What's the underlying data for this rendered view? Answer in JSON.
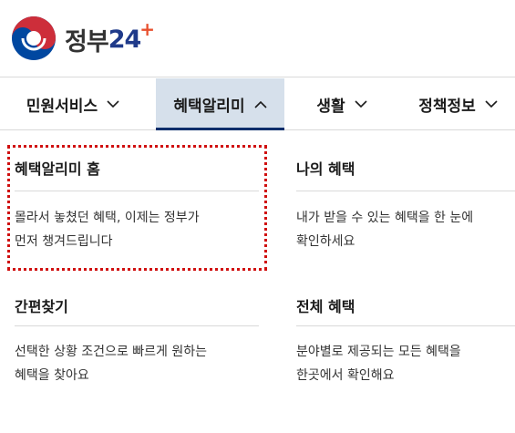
{
  "brand": {
    "name": "정부",
    "num": "24",
    "plus": "+"
  },
  "nav": [
    {
      "label": "민원서비스",
      "icon": "chevron-down-icon",
      "active": false
    },
    {
      "label": "혜택알리미",
      "icon": "chevron-up-icon",
      "active": true
    },
    {
      "label": "생활",
      "icon": "chevron-down-icon",
      "active": false
    },
    {
      "label": "정책정보",
      "icon": "chevron-down-icon",
      "active": false
    }
  ],
  "menu": [
    {
      "title": "혜택알리미 홈",
      "desc1": "몰라서 놓쳤던 혜택, 이제는 정부가",
      "desc2": "먼저 챙겨드립니다",
      "focused": true
    },
    {
      "title": "나의 혜택",
      "desc1": "내가 받을 수 있는 혜택을 한 눈에",
      "desc2": "확인하세요",
      "focused": false
    },
    {
      "title": "간편찾기",
      "desc1": "선택한 상황 조건으로 빠르게 원하는",
      "desc2": "혜택을 찾아요",
      "focused": false
    },
    {
      "title": "전체 혜택",
      "desc1": "분야별로 제공되는 모든 혜택을",
      "desc2": "한곳에서 확인해요",
      "focused": false
    }
  ],
  "colors": {
    "active_bg": "#d6e0eb",
    "active_bar": "#0b2e6b",
    "focus_outline": "#d01010",
    "logo_red": "#cd2e3a",
    "logo_blue": "#0047a0"
  }
}
